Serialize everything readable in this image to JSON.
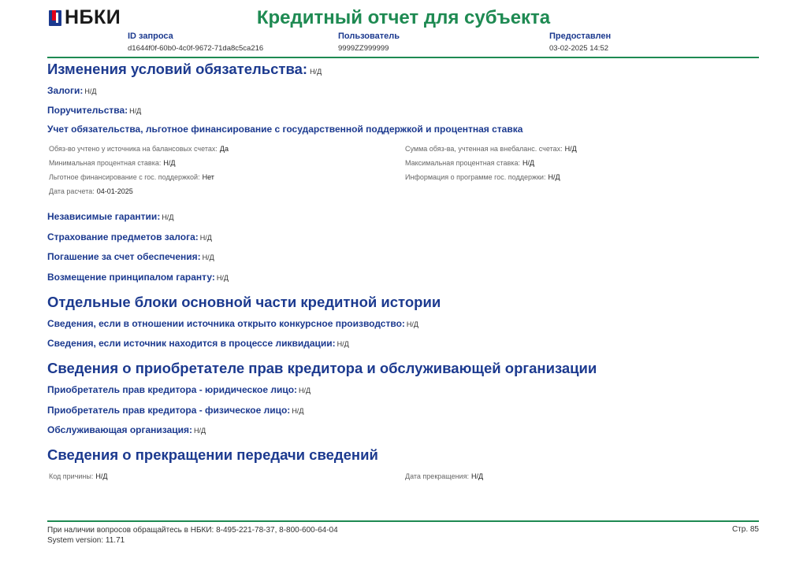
{
  "header": {
    "logo_text": "НБКИ",
    "title": "Кредитный отчет для субъекта",
    "meta": [
      {
        "label": "ID запроса",
        "value": "d1644f0f-60b0-4c0f-9672-71da8c5ca216"
      },
      {
        "label": "Пользователь",
        "value": "9999ZZ999999"
      },
      {
        "label": "Предоставлен",
        "value": "03-02-2025 14:52"
      }
    ]
  },
  "sections": {
    "changes": {
      "title": "Изменения условий обязательства:",
      "value": "Н/Д"
    },
    "collateral": {
      "title": "Залоги:",
      "value": "Н/Д"
    },
    "guarantees": {
      "title": "Поручительства:",
      "value": "Н/Д"
    },
    "accounting": {
      "title": "Учет обязательства, льготное финансирование с государственной поддержкой и процентная ставка",
      "left": [
        {
          "label": "Обяз-во учтено у источника на балансовых счетах:",
          "value": "Да"
        },
        {
          "label": "Минимальная процентная ставка:",
          "value": "Н/Д"
        },
        {
          "label": "Льготное финансирование с гос. поддержкой:",
          "value": "Нет"
        },
        {
          "label": "Дата расчета:",
          "value": "04-01-2025"
        }
      ],
      "right": [
        {
          "label": "Сумма обяз-ва, учтенная на внебаланс. счетах:",
          "value": "Н/Д"
        },
        {
          "label": "Максимальная процентная ставка:",
          "value": "Н/Д"
        },
        {
          "label": "Информация о программе гос. поддержки:",
          "value": "Н/Д"
        }
      ]
    },
    "independent_guarantees": {
      "title": "Независимые гарантии:",
      "value": "Н/Д"
    },
    "collateral_insurance": {
      "title": "Страхование предметов залога:",
      "value": "Н/Д"
    },
    "repayment_by_security": {
      "title": "Погашение за счет обеспечения:",
      "value": "Н/Д"
    },
    "principal_reimbursement": {
      "title": "Возмещение принципалом гаранту:",
      "value": "Н/Д"
    },
    "separate_blocks": {
      "title": "Отдельные блоки основной части кредитной истории"
    },
    "bankruptcy": {
      "title": "Сведения, если в отношении источника открыто конкурсное производство:",
      "value": "Н/Д"
    },
    "liquidation": {
      "title": "Сведения, если источник находится в процессе ликвидации:",
      "value": "Н/Д"
    },
    "acquirer": {
      "title": "Сведения о приобретателе прав кредитора и обслуживающей организации"
    },
    "acquirer_legal": {
      "title": "Приобретатель прав кредитора - юридическое лицо:",
      "value": "Н/Д"
    },
    "acquirer_person": {
      "title": "Приобретатель прав кредитора - физическое лицо:",
      "value": "Н/Д"
    },
    "servicing_org": {
      "title": "Обслуживающая организация:",
      "value": "Н/Д"
    },
    "termination": {
      "title": "Сведения о прекращении передачи сведений",
      "reason_label": "Код причины:",
      "reason_value": "Н/Д",
      "date_label": "Дата прекращения:",
      "date_value": "Н/Д"
    }
  },
  "footer": {
    "contact": "При наличии вопросов обращайтесь в НБКИ: 8-495-221-78-37, 8-800-600-64-04",
    "version": "System version: 11.71",
    "page": "Стр. 85"
  },
  "colors": {
    "brand_green": "#1e8a52",
    "heading_blue": "#1c3a8f",
    "logo_red": "#e2001a"
  }
}
